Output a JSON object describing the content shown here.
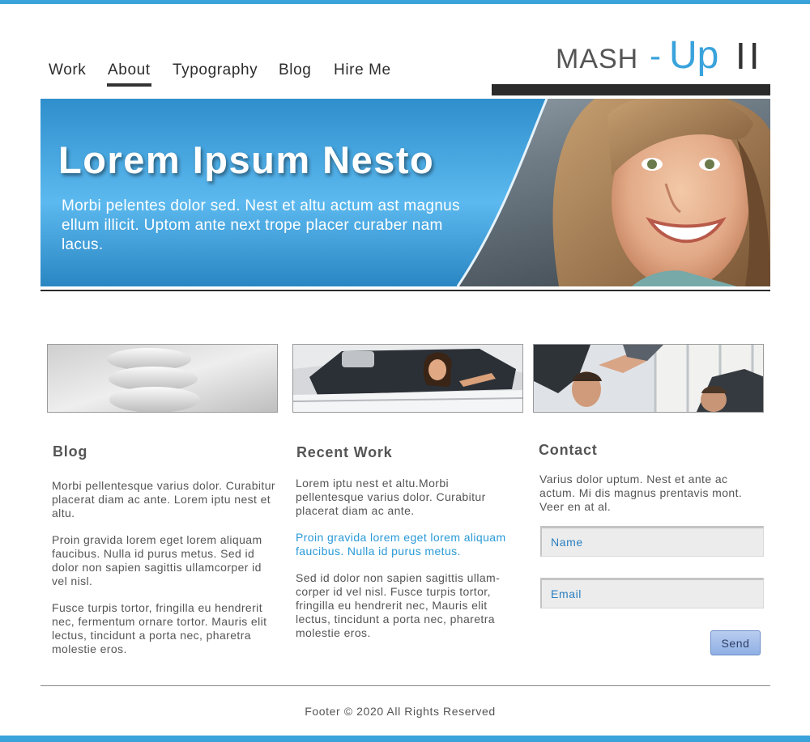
{
  "nav": {
    "items": [
      {
        "label": "Work",
        "active": false
      },
      {
        "label": "About",
        "active": true
      },
      {
        "label": "Typography",
        "active": false
      },
      {
        "label": "Blog",
        "active": false
      },
      {
        "label": "Hire Me",
        "active": false
      }
    ]
  },
  "logo": {
    "part1": "mash",
    "dash": "-",
    "part2": "Up",
    "part3": "II"
  },
  "banner": {
    "title": "Lorem Ipsum Nesto",
    "text": "Morbi pelentes dolor sed. Nest et altu actum ast magnus ellum illicit. Uptom ante next trope placer curaber nam lacus."
  },
  "columns": {
    "blog": {
      "title": "Blog",
      "paragraphs": [
        "Morbi pellentesque varius dolor. Curabitur placerat diam ac ante. Lorem iptu nest et altu.",
        "Proin gravida lorem eget lorem aliquam faucibus. Nulla id purus metus. Sed id dolor non sapien sagittis ullamcorper id vel nisl.",
        "Fusce turpis tortor, fringilla eu hendrerit nec, fermentum ornare tortor. Mauris elit lectus, tincidunt a porta nec, pharetra molestie eros."
      ]
    },
    "recent_work": {
      "title": "Recent Work",
      "paragraphs": [
        "Lorem iptu nest et altu.Morbi pellentesque varius dolor. Curabitur placerat diam ac ante.",
        "Proin gravida lorem eget lorem aliquam faucibus. Nulla id purus metus.",
        "Sed id dolor non sapien sagittis ullam-corper id vel nisl. Fusce turpis tortor, fringilla eu hendrerit nec, Mauris elit lectus, tincidunt a porta nec, pharetra molestie eros."
      ]
    },
    "contact": {
      "title": "Contact",
      "text": "Varius dolor uptum. Nest et ante ac actum. Mi dis magnus prentavis mont. Veer en at al.",
      "name_placeholder": "Name",
      "email_placeholder": "Email",
      "send_label": "Send"
    }
  },
  "thumbnails": [
    {
      "icon": "light-bulb-image"
    },
    {
      "icon": "woman-in-car-image"
    },
    {
      "icon": "handshake-image"
    }
  ],
  "footer": {
    "text": "Footer © 2020 All Rights Reserved"
  },
  "colors": {
    "accent": "#3aa3db",
    "dark": "#2b2b2b",
    "link": "#2a9ad8"
  }
}
